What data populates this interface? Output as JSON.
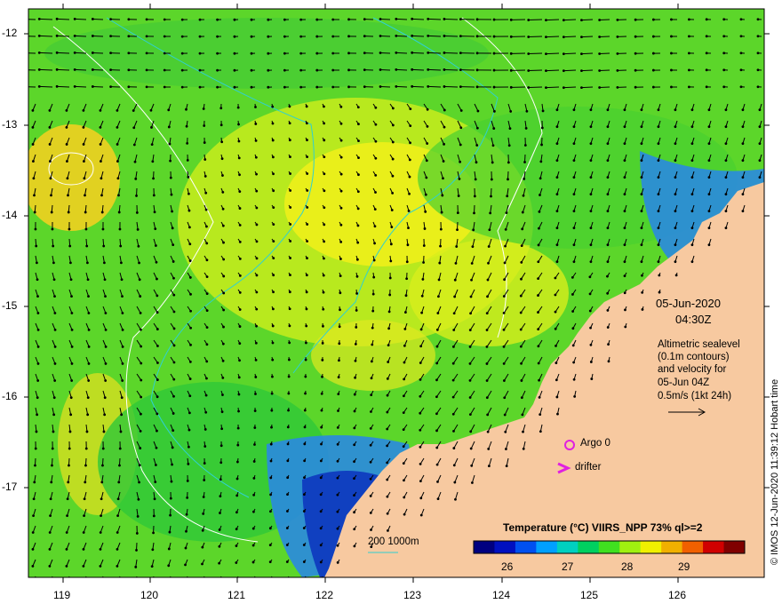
{
  "map": {
    "lat_ticks": [
      "-12",
      "-13",
      "-14",
      "-15",
      "-16",
      "-17"
    ],
    "lon_ticks": [
      "119",
      "120",
      "121",
      "122",
      "123",
      "124",
      "125",
      "126"
    ],
    "land_color": "#f7c9a0",
    "ocean_colors": [
      "#1bb83a",
      "#5cd62a",
      "#a6e820",
      "#e8f018",
      "#f0c020"
    ],
    "coastal_cold_colors": [
      "#2a8ae0",
      "#1040c0",
      "#101080"
    ]
  },
  "annotation": {
    "date": "05-Jun-2020",
    "time": "04:30Z",
    "altimetry_lines": [
      "Altimetric sealevel",
      "(0.1m contours)",
      "and velocity for",
      "05-Jun 04Z",
      "0.5m/s (1kt 24h)"
    ],
    "scale_arrow_icon": "long-arrow-icon"
  },
  "markers": {
    "argo_label": "Argo 0",
    "argo_icon": "circle-icon",
    "drifter_label": "drifter",
    "drifter_icon": "chevron-icon",
    "marker_color": "#e020e0"
  },
  "bathymetry": {
    "label": "200  1000m",
    "color_200": "#30d0d0",
    "color_1000": "#ffffff"
  },
  "colorbar": {
    "title": "Temperature (°C) VIIRS_NPP 73% ql>=2",
    "tick_labels": [
      "26",
      "27",
      "28",
      "29"
    ],
    "colors": [
      "#000080",
      "#0010c0",
      "#0050f0",
      "#00a0ff",
      "#00d0c0",
      "#00d060",
      "#40e020",
      "#a0f010",
      "#f0f000",
      "#f0b000",
      "#f06000",
      "#d00000",
      "#800000"
    ]
  },
  "credit": "© IMOS 12-Jun-2020 11:39:12 Hobart time"
}
